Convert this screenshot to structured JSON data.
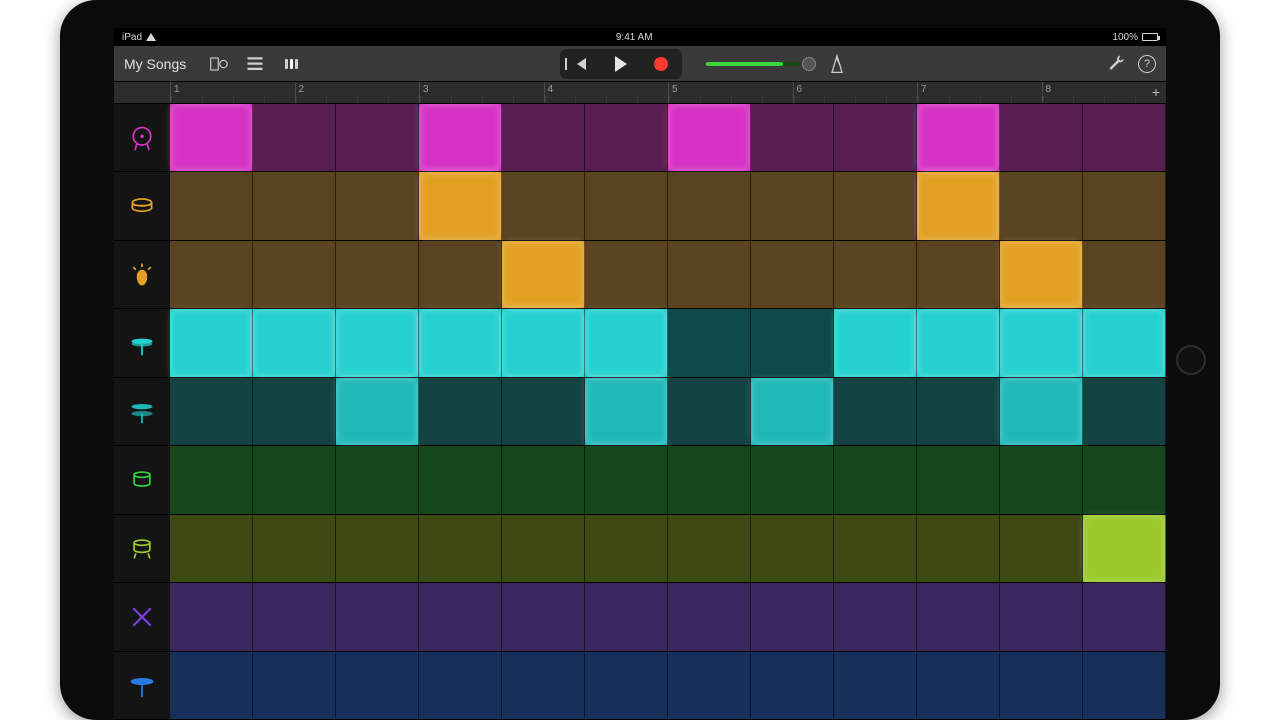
{
  "statusbar": {
    "device": "iPad",
    "time": "9:41 AM",
    "battery": "100%"
  },
  "toolbar": {
    "back_label": "My Songs"
  },
  "ruler": {
    "bars": [
      "1",
      "2",
      "3",
      "4",
      "5",
      "6",
      "7",
      "8"
    ]
  },
  "colors": {
    "magenta_dim": "#5a1f52",
    "magenta_bright": "#d631c4",
    "orange_dim": "#5a4320",
    "orange_bright": "#e3a124",
    "cyan_dim": "#0e4a4a",
    "cyan_bright": "#25d0d0",
    "teal_dim": "#134343",
    "teal_bright": "#1fb8b8",
    "green_dim": "#15461c",
    "green_bright": "#2fd33a",
    "olive_dim": "#3d4a14",
    "olive_bright": "#9ac92a",
    "purple_dim": "#3a2760",
    "purple_bright": "#7a3fe0",
    "blue_dim": "#16305a",
    "blue_bright": "#2a7ae0"
  },
  "tracks": [
    {
      "icon": "kick",
      "color": "magenta",
      "active": [
        0,
        3,
        6,
        9
      ]
    },
    {
      "icon": "snare",
      "color": "orange",
      "active": [
        3,
        9
      ]
    },
    {
      "icon": "clap",
      "color": "orange",
      "active": [
        4,
        10
      ]
    },
    {
      "icon": "hihat-c",
      "color": "cyan",
      "active": [
        0,
        1,
        2,
        3,
        4,
        5,
        8,
        9,
        10,
        11
      ]
    },
    {
      "icon": "hihat-o",
      "color": "teal",
      "active": [
        2,
        5,
        7,
        10
      ]
    },
    {
      "icon": "tom-lo",
      "color": "green",
      "active": []
    },
    {
      "icon": "tom-hi",
      "color": "olive",
      "active": [
        11
      ]
    },
    {
      "icon": "sticks",
      "color": "purple",
      "active": []
    },
    {
      "icon": "crash",
      "color": "blue",
      "active": []
    }
  ],
  "steps_per_row": 12
}
